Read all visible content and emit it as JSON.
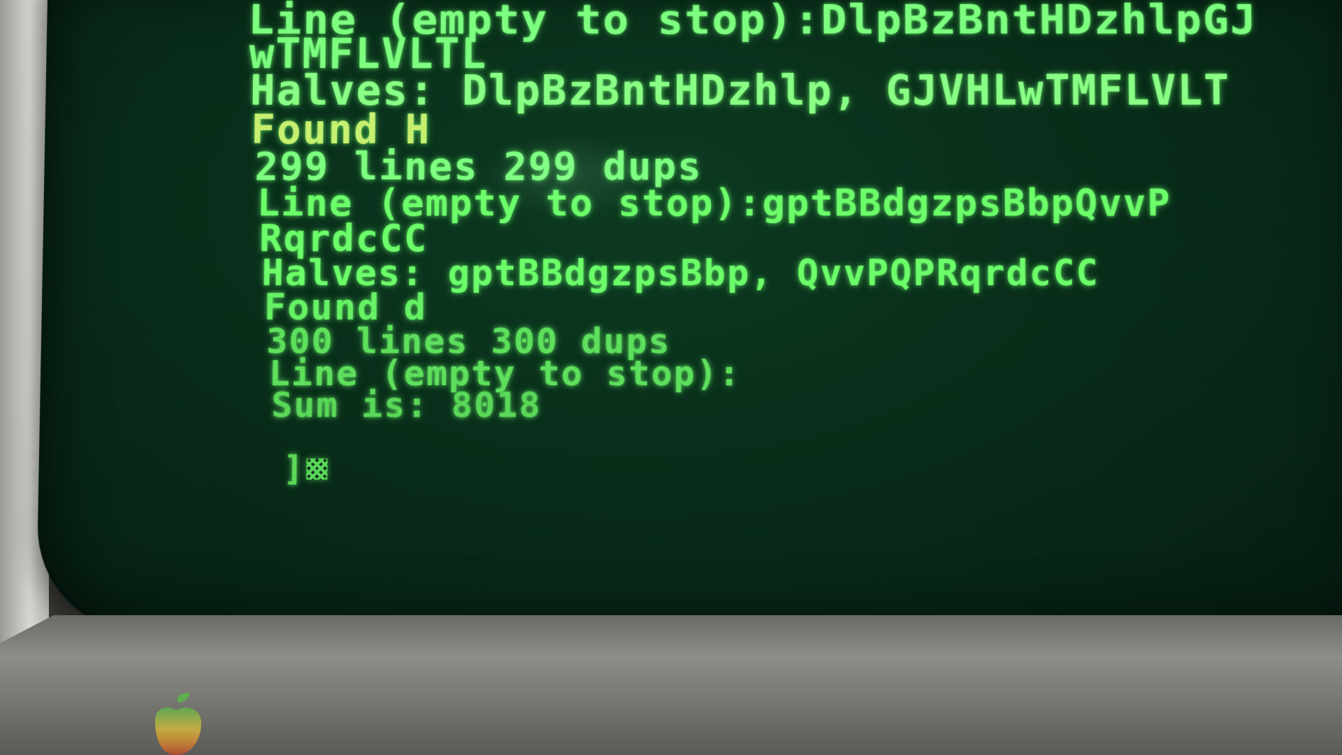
{
  "terminal": {
    "lines": [
      "Line (empty to stop):DlpBzBntHDzhlpGJ",
      "wTMFLVLTL",
      "Halves: DlpBzBntHDzhlp, GJVHLwTMFLVLT",
      "Found H",
      "299 lines 299 dups",
      "Line (empty to stop):gptBBdgzpsBbpQvvP",
      "RqrdcCC",
      "Halves: gptBBdgzpsBbp, QvvPQPRqrdcCC",
      "Found d",
      "300 lines 300 dups",
      "Line (empty to stop):",
      "Sum is: 8018"
    ],
    "prompt": "]"
  },
  "colors": {
    "phosphor": "#6cff6a",
    "screen": "#0a2e1b"
  },
  "icons": {
    "cursor": "block-cursor-icon",
    "logo": "apple-logo-icon"
  }
}
